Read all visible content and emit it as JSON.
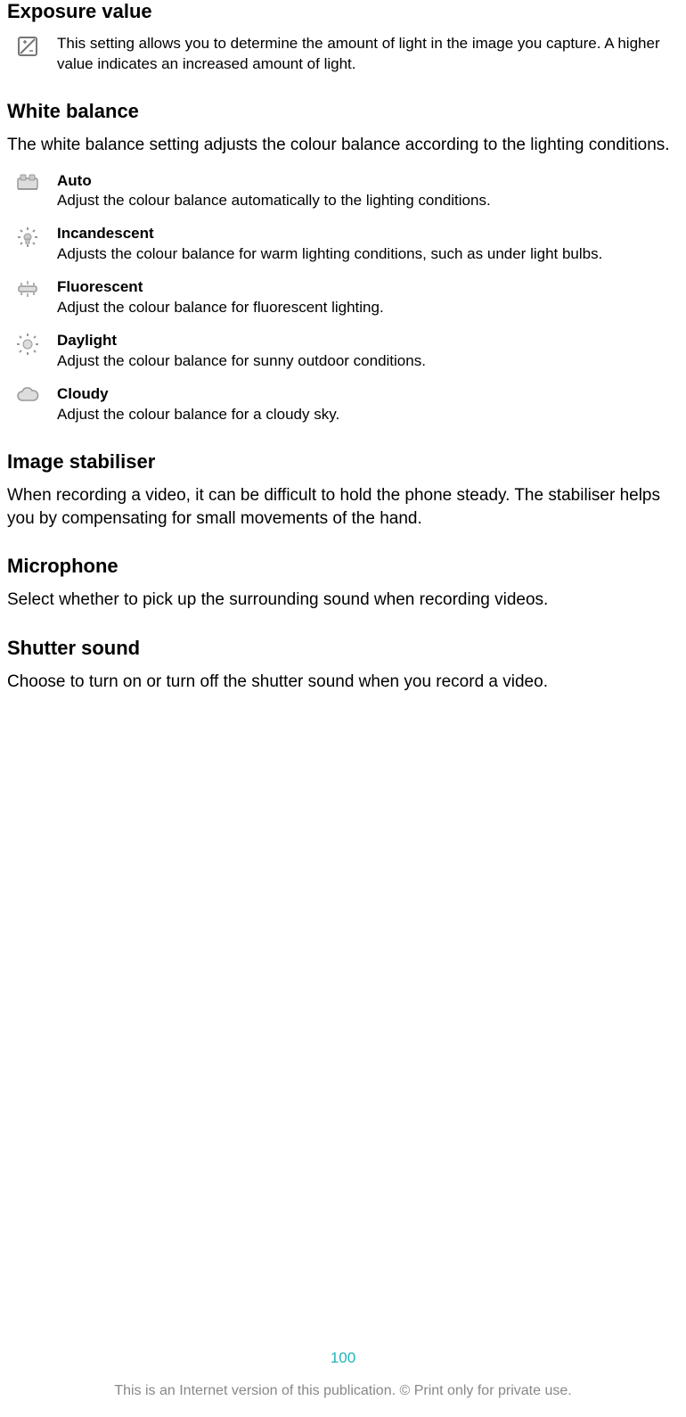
{
  "sections": {
    "exposure": {
      "title": "Exposure value",
      "desc": "This setting allows you to determine the amount of light in the image you capture. A higher value indicates an increased amount of light."
    },
    "whitebalance": {
      "title": "White balance",
      "intro": "The white balance setting adjusts the colour balance according to the lighting conditions.",
      "options": {
        "auto": {
          "label": "Auto",
          "desc": "Adjust the colour balance automatically to the lighting conditions."
        },
        "incandescent": {
          "label": "Incandescent",
          "desc": "Adjusts the colour balance for warm lighting conditions, such as under light bulbs."
        },
        "fluorescent": {
          "label": "Fluorescent",
          "desc": "Adjust the colour balance for fluorescent lighting."
        },
        "daylight": {
          "label": "Daylight",
          "desc": "Adjust the colour balance for sunny outdoor conditions."
        },
        "cloudy": {
          "label": "Cloudy",
          "desc": "Adjust the colour balance for a cloudy sky."
        }
      }
    },
    "stabiliser": {
      "title": "Image stabiliser",
      "desc": "When recording a video, it can be difficult to hold the phone steady. The stabiliser helps you by compensating for small movements of the hand."
    },
    "microphone": {
      "title": "Microphone",
      "desc": "Select whether to pick up the surrounding sound when recording videos."
    },
    "shutter": {
      "title": "Shutter sound",
      "desc": "Choose to turn on or turn off the shutter sound when you record a video."
    }
  },
  "footer": {
    "page": "100",
    "note": "This is an Internet version of this publication. © Print only for private use."
  }
}
